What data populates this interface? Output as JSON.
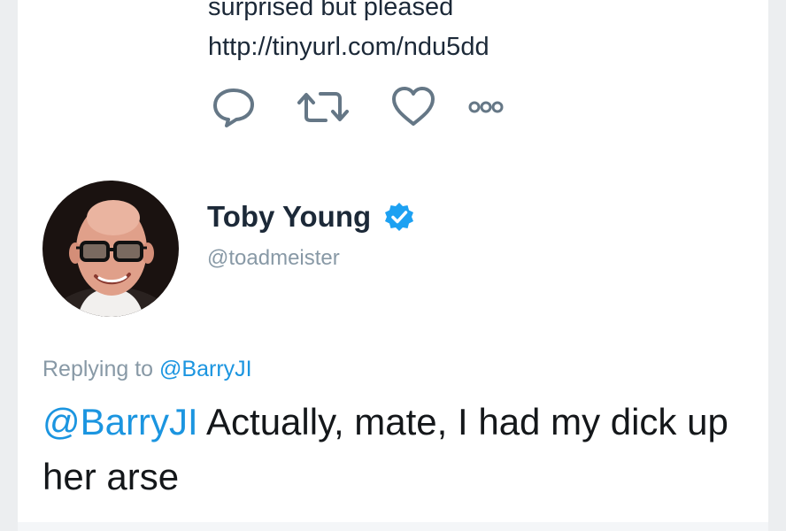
{
  "previous_tweet": {
    "text_lines": [
      "surprised but pleased",
      "http://tinyurl.com/ndu5dd"
    ]
  },
  "actions": {
    "reply_icon": "reply-icon",
    "retweet_icon": "retweet-icon",
    "like_icon": "heart-icon",
    "more_icon": "more-icon"
  },
  "tweet": {
    "author_name": "Toby Young",
    "author_handle": "@toadmeister",
    "verified": true,
    "replying_prefix": "Replying to",
    "replying_to": "@BarryJI",
    "body_mention": "@BarryJI",
    "body_text": " Actually, mate, I had my dick up her arse"
  },
  "colors": {
    "link": "#1b95e0",
    "text": "#14171a",
    "secondary": "#8899a6",
    "icon": "#657786"
  }
}
